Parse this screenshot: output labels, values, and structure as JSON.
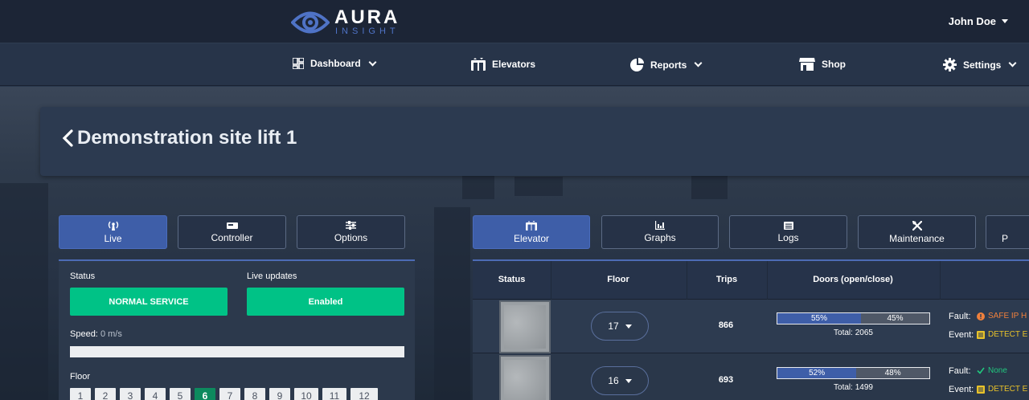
{
  "brand": {
    "name": "AURA",
    "sub": "INSIGHT"
  },
  "user": {
    "name": "John Doe"
  },
  "nav": {
    "dashboard": "Dashboard",
    "elevators": "Elevators",
    "reports": "Reports",
    "shop": "Shop",
    "settings": "Settings"
  },
  "page": {
    "title": "Demonstration site lift 1"
  },
  "left_tabs": {
    "live": "Live",
    "controller": "Controller",
    "options": "Options"
  },
  "live_panel": {
    "status_label": "Status",
    "status_value": "NORMAL SERVICE",
    "live_updates_label": "Live updates",
    "live_updates_value": "Enabled",
    "speed_label": "Speed:",
    "speed_value": "0 m/s",
    "floor_label": "Floor",
    "floors": [
      "1",
      "2",
      "3",
      "4",
      "5",
      "6",
      "7",
      "8",
      "9",
      "10",
      "11",
      "12"
    ],
    "active_floor": "6"
  },
  "right_tabs": {
    "elevator": "Elevator",
    "graphs": "Graphs",
    "logs": "Logs",
    "maintenance": "Maintenance",
    "more": "P"
  },
  "table": {
    "headers": {
      "status": "Status",
      "floor": "Floor",
      "trips": "Trips",
      "doors": "Doors (open/close)"
    },
    "rows": [
      {
        "floor": "17",
        "trips": "866",
        "open_pct": "55%",
        "close_pct": "45%",
        "open_fraction": 0.55,
        "total": "Total: 2065",
        "fault_label": "Fault:",
        "fault_value": "SAFE IP H",
        "fault_color": "#f0803c",
        "event_label": "Event:",
        "event_value": "DETECT E",
        "event_color": "#e8c22a"
      },
      {
        "floor": "16",
        "trips": "693",
        "open_pct": "52%",
        "close_pct": "48%",
        "open_fraction": 0.52,
        "total": "Total: 1499",
        "fault_label": "Fault:",
        "fault_value": "None",
        "fault_color": "#21c77e",
        "event_label": "Event:",
        "event_value": "DETECT E",
        "event_color": "#e8c22a"
      }
    ]
  },
  "colors": {
    "accent": "#3e5ea8",
    "success": "#00c286",
    "active_floor": "#0d8a5e"
  }
}
